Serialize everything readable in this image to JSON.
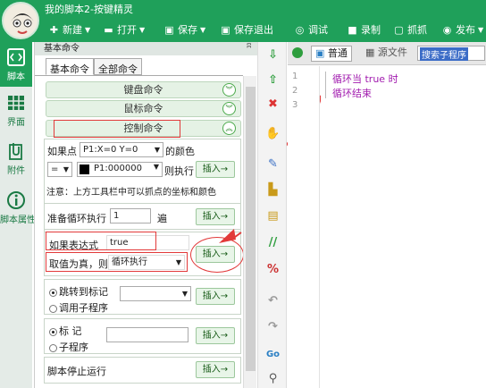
{
  "window": {
    "title": "我的脚本2-按键精灵",
    "toolbar": [
      {
        "icon": "plus-icon",
        "label": "新建",
        "dropdown": true
      },
      {
        "icon": "folder-open-icon",
        "label": "打开",
        "dropdown": true
      },
      {
        "icon": "save-icon",
        "label": "保存",
        "dropdown": true
      },
      {
        "icon": "save-exit-icon",
        "label": "保存退出",
        "dropdown": false
      },
      {
        "icon": "debug-icon",
        "label": "调试",
        "dropdown": false
      },
      {
        "icon": "record-icon",
        "label": "录制",
        "dropdown": false
      },
      {
        "icon": "capture-icon",
        "label": "抓抓",
        "dropdown": false
      },
      {
        "icon": "publish-icon",
        "label": "发布",
        "dropdown": true
      }
    ]
  },
  "sidebar": {
    "items": [
      {
        "label": "脚本",
        "icon": "script-icon",
        "active": true
      },
      {
        "label": "界面",
        "icon": "interface-icon",
        "active": false
      },
      {
        "label": "附件",
        "icon": "attachment-icon",
        "active": false
      },
      {
        "label": "脚本属性",
        "icon": "info-icon",
        "active": false
      }
    ]
  },
  "panel": {
    "title": "基本命令",
    "pin": "ʭ",
    "tabs": [
      "基本命令",
      "全部命令"
    ],
    "groups": [
      "键盘命令",
      "鼠标命令",
      "控制命令"
    ],
    "color_check": {
      "prefix": "如果点",
      "point_value": "P1:X=0 Y=0",
      "suffix": "的颜色",
      "operator": "=",
      "color_value": "P1:000000",
      "then": "则执行",
      "insert": "插入→",
      "note": "注意：上方工具栏中可以抓点的坐标和颜色"
    },
    "loop": {
      "prefix": "准备循环执行",
      "value": "1",
      "suffix": "遍",
      "insert": "插入→"
    },
    "if_expr": {
      "label": "如果表达式",
      "value": "true",
      "then_label": "取值为真，则",
      "then_value": "循环执行",
      "insert": "插入→"
    },
    "jump": {
      "option1": "跳转到标记",
      "option2": "调用子程序",
      "insert": "插入→"
    },
    "label_opt": {
      "option1": "标 记",
      "option2": "子程序",
      "insert": "插入→"
    },
    "stop": {
      "label": "脚本停止运行",
      "insert": "插入→"
    }
  },
  "editor": {
    "tabs": [
      {
        "label": "普通",
        "active": true
      },
      {
        "label": "源文件",
        "active": false
      }
    ],
    "search_text": "搜索子程序",
    "lines": [
      "循环当 true 时",
      "循环结束"
    ],
    "line_numbers": [
      "1",
      "2",
      "3"
    ]
  },
  "colors": {
    "accent": "#1fa05a",
    "highlight": "#e23a3a",
    "code": "#a21caf"
  }
}
